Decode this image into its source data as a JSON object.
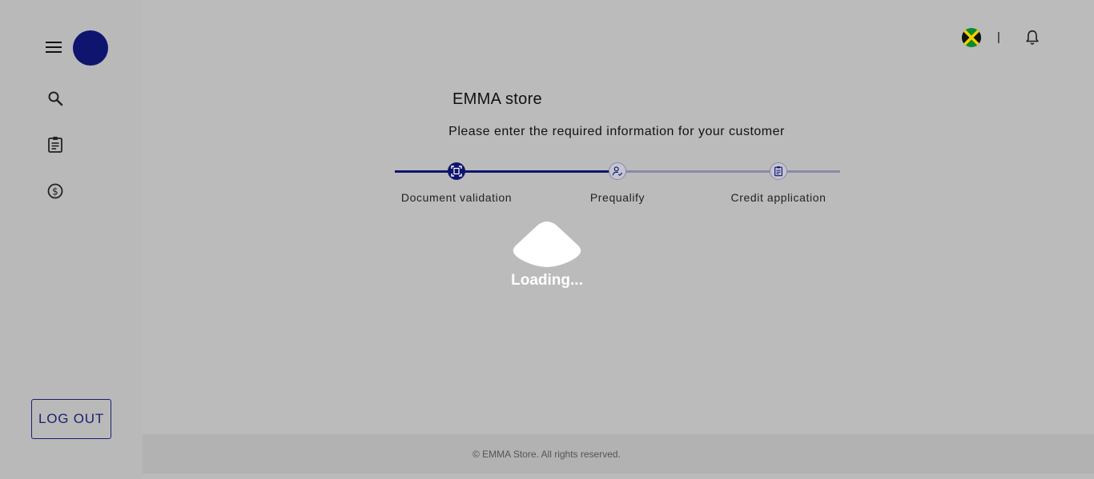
{
  "header": {
    "flag_icon": "jamaica-flag-icon",
    "separator": "|",
    "bell_icon": "bell-icon"
  },
  "sidebar": {
    "menu_icon": "hamburger-menu-icon",
    "items": [
      {
        "name": "search",
        "icon": "search-icon"
      },
      {
        "name": "applications",
        "icon": "clipboard-icon"
      },
      {
        "name": "payments",
        "icon": "dollar-circle-icon"
      }
    ],
    "logout_label": "LOG OUT"
  },
  "main": {
    "title": "EMMA store",
    "subtitle": "Please enter the required information for your customer",
    "steps": [
      {
        "label": "Document validation",
        "icon": "document-scan-icon",
        "active": true
      },
      {
        "label": "Prequalify",
        "icon": "person-check-icon",
        "active": false
      },
      {
        "label": "Credit application",
        "icon": "clipboard-list-icon",
        "active": false
      }
    ],
    "loading_text": "Loading..."
  },
  "footer": {
    "copyright": "© EMMA Store. All rights reserved."
  },
  "colors": {
    "primary": "#0f146e",
    "inactive_step": "#8a8aa8",
    "background": "#bbbbbb"
  }
}
